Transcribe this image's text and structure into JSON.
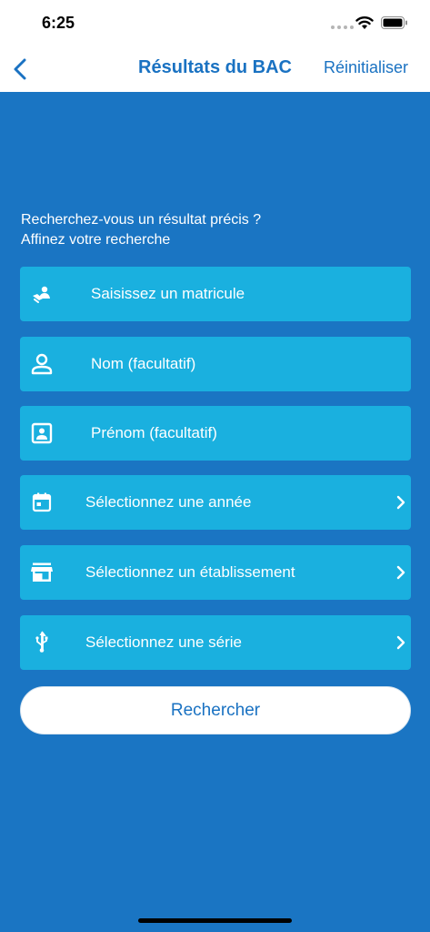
{
  "status_bar": {
    "time": "6:25"
  },
  "nav": {
    "title": "Résultats du BAC",
    "reset_label": "Réinitialiser"
  },
  "prompt": {
    "line1": "Recherchez-vous un résultat précis ?",
    "line2": "Affinez votre recherche"
  },
  "fields": {
    "matricule": {
      "placeholder": "Saisissez un matricule",
      "icon": "id-badge-icon"
    },
    "nom": {
      "placeholder": "Nom (facultatif)",
      "icon": "person-icon"
    },
    "prenom": {
      "placeholder": "Prénom (facultatif)",
      "icon": "contact-card-icon"
    },
    "annee": {
      "label": "Sélectionnez une année",
      "icon": "calendar-icon"
    },
    "etablissement": {
      "label": "Sélectionnez un établissement",
      "icon": "storefront-icon"
    },
    "serie": {
      "label": "Sélectionnez une série",
      "icon": "usb-icon"
    }
  },
  "search_button": {
    "label": "Rechercher"
  },
  "colors": {
    "background": "#1a75c3",
    "field": "#1ab0df",
    "accent": "#1a72c2",
    "header": "#ffffff"
  }
}
